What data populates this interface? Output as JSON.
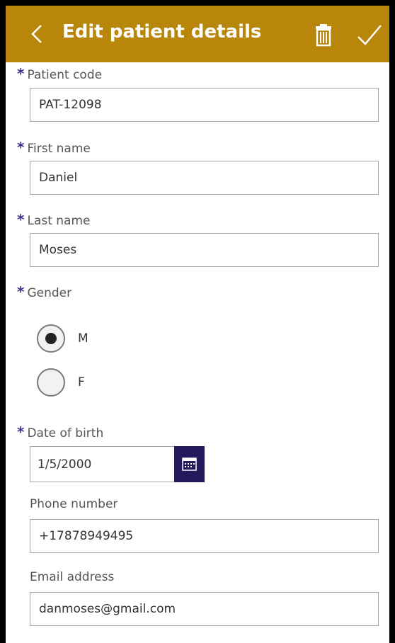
{
  "header": {
    "title": "Edit patient details",
    "bg_color": "#b8860b"
  },
  "required_marker": "*",
  "fields": {
    "patient_code": {
      "label": "Patient code",
      "value": "PAT-12098"
    },
    "first_name": {
      "label": "First name",
      "value": "Daniel"
    },
    "last_name": {
      "label": "Last name",
      "value": "Moses"
    },
    "gender": {
      "label": "Gender",
      "options": [
        {
          "label": "M",
          "selected": true
        },
        {
          "label": "F",
          "selected": false
        }
      ]
    },
    "date_of_birth": {
      "label": "Date of birth",
      "value": "1/5/2000"
    },
    "phone_number": {
      "label": "Phone number",
      "value": "+17878949495"
    },
    "email_address": {
      "label": "Email address",
      "value": "danmoses@gmail.com"
    }
  },
  "colors": {
    "accent": "#231a5c",
    "required": "#3a3490"
  },
  "icons": [
    "chevron-left-icon",
    "trash-icon",
    "checkmark-icon",
    "calendar-icon"
  ]
}
